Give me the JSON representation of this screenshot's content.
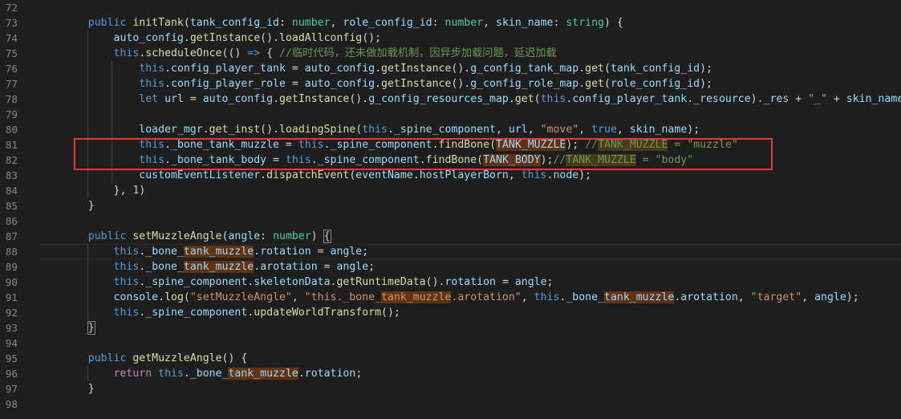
{
  "editor": {
    "line_numbers": [
      "72",
      "73",
      "74",
      "75",
      "76",
      "77",
      "78",
      "79",
      "80",
      "81",
      "82",
      "83",
      "84",
      "85",
      "86",
      "87",
      "88",
      "89",
      "90",
      "91",
      "92",
      "93",
      "94",
      "95",
      "96",
      "97",
      "98"
    ],
    "lines": [
      [],
      [
        [
          "    ",
          "pl"
        ],
        [
          "public",
          "kw"
        ],
        [
          " ",
          "pl"
        ],
        [
          "initTank",
          "fn"
        ],
        [
          "(",
          "pl"
        ],
        [
          "tank_config_id",
          "var"
        ],
        [
          ": ",
          "pl"
        ],
        [
          "number",
          "type"
        ],
        [
          ", ",
          "pl"
        ],
        [
          "role_config_id",
          "var"
        ],
        [
          ": ",
          "pl"
        ],
        [
          "number",
          "type"
        ],
        [
          ", ",
          "pl"
        ],
        [
          "skin_name",
          "var"
        ],
        [
          ": ",
          "pl"
        ],
        [
          "string",
          "type"
        ],
        [
          ") {",
          "pl"
        ]
      ],
      [
        [
          "        ",
          "pl"
        ],
        [
          "auto_config",
          "var"
        ],
        [
          ".",
          "pl"
        ],
        [
          "getInstance",
          "fn"
        ],
        [
          "().",
          "pl"
        ],
        [
          "loadAllconfig",
          "fn"
        ],
        [
          "();",
          "pl"
        ]
      ],
      [
        [
          "        ",
          "pl"
        ],
        [
          "this",
          "kw"
        ],
        [
          ".",
          "pl"
        ],
        [
          "scheduleOnce",
          "fn"
        ],
        [
          "(() ",
          "pl"
        ],
        [
          "=>",
          "kw"
        ],
        [
          " { ",
          "pl"
        ],
        [
          "//临时代码，还未做加载机制，因异步加载问题，延迟加载",
          "cm"
        ]
      ],
      [
        [
          "            ",
          "pl"
        ],
        [
          "this",
          "kw"
        ],
        [
          ".",
          "pl"
        ],
        [
          "config_player_tank",
          "var"
        ],
        [
          " = ",
          "pl"
        ],
        [
          "auto_config",
          "var"
        ],
        [
          ".",
          "pl"
        ],
        [
          "getInstance",
          "fn"
        ],
        [
          "().",
          "pl"
        ],
        [
          "g_config_tank_map",
          "var"
        ],
        [
          ".",
          "pl"
        ],
        [
          "get",
          "fn"
        ],
        [
          "(",
          "pl"
        ],
        [
          "tank_config_id",
          "var"
        ],
        [
          ");",
          "pl"
        ]
      ],
      [
        [
          "            ",
          "pl"
        ],
        [
          "this",
          "kw"
        ],
        [
          ".",
          "pl"
        ],
        [
          "config_player_role",
          "var"
        ],
        [
          " = ",
          "pl"
        ],
        [
          "auto_config",
          "var"
        ],
        [
          ".",
          "pl"
        ],
        [
          "getInstance",
          "fn"
        ],
        [
          "().",
          "pl"
        ],
        [
          "g_config_role_map",
          "var"
        ],
        [
          ".",
          "pl"
        ],
        [
          "get",
          "fn"
        ],
        [
          "(",
          "pl"
        ],
        [
          "role_config_id",
          "var"
        ],
        [
          ");",
          "pl"
        ]
      ],
      [
        [
          "            ",
          "pl"
        ],
        [
          "let",
          "kw"
        ],
        [
          " ",
          "pl"
        ],
        [
          "url",
          "var"
        ],
        [
          " = ",
          "pl"
        ],
        [
          "auto_config",
          "var"
        ],
        [
          ".",
          "pl"
        ],
        [
          "getInstance",
          "fn"
        ],
        [
          "().",
          "pl"
        ],
        [
          "g_config_resources_map",
          "var"
        ],
        [
          ".",
          "pl"
        ],
        [
          "get",
          "fn"
        ],
        [
          "(",
          "pl"
        ],
        [
          "this",
          "kw"
        ],
        [
          ".",
          "pl"
        ],
        [
          "config_player_tank",
          "var"
        ],
        [
          ".",
          "pl"
        ],
        [
          "_resource",
          "var"
        ],
        [
          ").",
          "pl"
        ],
        [
          "_res",
          "var"
        ],
        [
          " + ",
          "pl"
        ],
        [
          "\"_\"",
          "str"
        ],
        [
          " + ",
          "pl"
        ],
        [
          "skin_name",
          "var"
        ],
        [
          ";",
          "pl"
        ]
      ],
      [],
      [
        [
          "            ",
          "pl"
        ],
        [
          "loader_mgr",
          "var"
        ],
        [
          ".",
          "pl"
        ],
        [
          "get_inst",
          "fn"
        ],
        [
          "().",
          "pl"
        ],
        [
          "loadingSpine",
          "fn"
        ],
        [
          "(",
          "pl"
        ],
        [
          "this",
          "kw"
        ],
        [
          ".",
          "pl"
        ],
        [
          "_spine_component",
          "var"
        ],
        [
          ", ",
          "pl"
        ],
        [
          "url",
          "var"
        ],
        [
          ", ",
          "pl"
        ],
        [
          "\"move\"",
          "str"
        ],
        [
          ", ",
          "pl"
        ],
        [
          "true",
          "kw"
        ],
        [
          ", ",
          "pl"
        ],
        [
          "skin_name",
          "var"
        ],
        [
          ");",
          "pl"
        ]
      ],
      [
        [
          "            ",
          "pl"
        ],
        [
          "this",
          "kw"
        ],
        [
          ".",
          "pl"
        ],
        [
          "_bone_tank_muzzle",
          "var"
        ],
        [
          " = ",
          "pl"
        ],
        [
          "this",
          "kw"
        ],
        [
          ".",
          "pl"
        ],
        [
          "_spine_component",
          "var"
        ],
        [
          ".",
          "pl"
        ],
        [
          "findBone",
          "fn"
        ],
        [
          "(",
          "pl"
        ],
        [
          "TANK_MUZZLE",
          "var",
          "hl"
        ],
        [
          "); ",
          "pl"
        ],
        [
          "//",
          "cm"
        ],
        [
          "TANK_MUZZLE",
          "cm",
          "hl-cm"
        ],
        [
          " = \"muzzle\"",
          "cm"
        ]
      ],
      [
        [
          "            ",
          "pl"
        ],
        [
          "this",
          "kw"
        ],
        [
          ".",
          "pl"
        ],
        [
          "_bone_tank_body",
          "var"
        ],
        [
          " = ",
          "pl"
        ],
        [
          "this",
          "kw"
        ],
        [
          ".",
          "pl"
        ],
        [
          "_spine_component",
          "var"
        ],
        [
          ".",
          "pl"
        ],
        [
          "findBone",
          "fn"
        ],
        [
          "(",
          "pl"
        ],
        [
          "TANK_BODY",
          "var",
          "hl"
        ],
        [
          ");",
          "pl"
        ],
        [
          "//",
          "cm"
        ],
        [
          "TANK_MUZZLE",
          "cm",
          "hl-cm"
        ],
        [
          " = \"body\"",
          "cm"
        ]
      ],
      [
        [
          "            ",
          "pl"
        ],
        [
          "customEventListener",
          "var"
        ],
        [
          ".",
          "pl"
        ],
        [
          "dispatchEvent",
          "fn"
        ],
        [
          "(",
          "pl"
        ],
        [
          "eventName",
          "var"
        ],
        [
          ".",
          "pl"
        ],
        [
          "hostPlayerBorn",
          "var"
        ],
        [
          ", ",
          "pl"
        ],
        [
          "this",
          "kw"
        ],
        [
          ".",
          "pl"
        ],
        [
          "node",
          "var"
        ],
        [
          ");",
          "pl"
        ]
      ],
      [
        [
          "        ",
          "pl"
        ],
        [
          "}, ",
          "pl"
        ],
        [
          "1",
          "num"
        ],
        [
          ")",
          "pl"
        ]
      ],
      [
        [
          "    ",
          "pl"
        ],
        [
          "}",
          "pl"
        ]
      ],
      [],
      [
        [
          "    ",
          "pl"
        ],
        [
          "public",
          "kw"
        ],
        [
          " ",
          "pl"
        ],
        [
          "setMuzzleAngle",
          "fn"
        ],
        [
          "(",
          "pl"
        ],
        [
          "angle",
          "var"
        ],
        [
          ": ",
          "pl"
        ],
        [
          "number",
          "type"
        ],
        [
          ") ",
          "pl"
        ],
        [
          "{",
          "pl",
          "brk"
        ]
      ],
      [
        [
          "        ",
          "pl"
        ],
        [
          "this",
          "kw"
        ],
        [
          ".",
          "pl"
        ],
        [
          "_bone_",
          "var"
        ],
        [
          "tank_muzzle",
          "var",
          "hl"
        ],
        [
          ".",
          "pl"
        ],
        [
          "rotation",
          "var"
        ],
        [
          " = ",
          "pl"
        ],
        [
          "angle",
          "var"
        ],
        [
          ";",
          "pl"
        ]
      ],
      [
        [
          "        ",
          "pl"
        ],
        [
          "this",
          "kw"
        ],
        [
          ".",
          "pl"
        ],
        [
          "_bone_",
          "var"
        ],
        [
          "tank_muzzle",
          "var",
          "hl"
        ],
        [
          ".",
          "pl"
        ],
        [
          "arotation",
          "var"
        ],
        [
          " = ",
          "pl"
        ],
        [
          "angle",
          "var"
        ],
        [
          ";",
          "pl"
        ]
      ],
      [
        [
          "        ",
          "pl"
        ],
        [
          "this",
          "kw"
        ],
        [
          ".",
          "pl"
        ],
        [
          "_spine_component",
          "var"
        ],
        [
          ".",
          "pl"
        ],
        [
          "skeletonData",
          "var"
        ],
        [
          ".",
          "pl"
        ],
        [
          "getRuntimeData",
          "fn"
        ],
        [
          "().",
          "pl"
        ],
        [
          "rotation",
          "var"
        ],
        [
          " = ",
          "pl"
        ],
        [
          "angle",
          "var"
        ],
        [
          ";",
          "pl"
        ]
      ],
      [
        [
          "        ",
          "pl"
        ],
        [
          "console",
          "var"
        ],
        [
          ".",
          "pl"
        ],
        [
          "log",
          "fn"
        ],
        [
          "(",
          "pl"
        ],
        [
          "\"setMuzzleAngle\"",
          "str"
        ],
        [
          ", ",
          "pl"
        ],
        [
          "\"this._bone_",
          "str"
        ],
        [
          "tank_muzzle",
          "str",
          "hl"
        ],
        [
          ".arotation\"",
          "str"
        ],
        [
          ", ",
          "pl"
        ],
        [
          "this",
          "kw"
        ],
        [
          ".",
          "pl"
        ],
        [
          "_bone_",
          "var"
        ],
        [
          "tank_muzzle",
          "var",
          "hl"
        ],
        [
          ".",
          "pl"
        ],
        [
          "arotation",
          "var"
        ],
        [
          ", ",
          "pl"
        ],
        [
          "\"target\"",
          "str"
        ],
        [
          ", ",
          "pl"
        ],
        [
          "angle",
          "var"
        ],
        [
          ");",
          "pl"
        ]
      ],
      [
        [
          "        ",
          "pl"
        ],
        [
          "this",
          "kw"
        ],
        [
          ".",
          "pl"
        ],
        [
          "_spine_component",
          "var"
        ],
        [
          ".",
          "pl"
        ],
        [
          "updateWorldTransform",
          "fn"
        ],
        [
          "();",
          "pl"
        ]
      ],
      [
        [
          "    ",
          "pl"
        ],
        [
          "}",
          "pl",
          "brk"
        ]
      ],
      [],
      [
        [
          "    ",
          "pl"
        ],
        [
          "public",
          "kw"
        ],
        [
          " ",
          "pl"
        ],
        [
          "getMuzzleAngle",
          "fn"
        ],
        [
          "() {",
          "pl"
        ]
      ],
      [
        [
          "        ",
          "pl"
        ],
        [
          "return",
          "ctrl"
        ],
        [
          " ",
          "pl"
        ],
        [
          "this",
          "kw"
        ],
        [
          ".",
          "pl"
        ],
        [
          "_bone_",
          "var"
        ],
        [
          "tank_muzzle",
          "var",
          "hl"
        ],
        [
          ".",
          "pl"
        ],
        [
          "rotation",
          "var"
        ],
        [
          ";",
          "pl"
        ]
      ],
      [
        [
          "    ",
          "pl"
        ],
        [
          "}",
          "pl"
        ]
      ],
      []
    ]
  }
}
